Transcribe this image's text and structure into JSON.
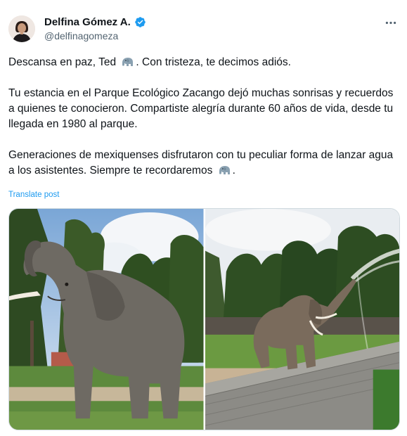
{
  "author": {
    "name": "Delfina Gómez A.",
    "handle": "@delfinagomeza",
    "verified": true,
    "avatar_icon": "avatar"
  },
  "tweet": {
    "line1_a": "Descansa en paz, Ted",
    "line1_b": ". Con tristeza, te decimos adiós.",
    "para2": "Tu estancia en el Parque Ecológico Zacango dejó muchas sonrisas y recuerdos a quienes te conocieron. Compartiste alegría durante 60 años de vida, desde tu llegada en 1980 al parque.",
    "para3_a": "Generaciones de mexiquenses disfrutaron con tu peculiar forma de lanzar agua a los asistentes. Siempre te recordaremos",
    "para3_b": ".",
    "emoji": "elephant-emoji"
  },
  "translate_label": "Translate post",
  "media": {
    "photo_count": 2,
    "photo1": "elephant-trunk-raised",
    "photo2": "elephant-spraying-water"
  },
  "colors": {
    "link": "#1d9bf0",
    "secondary_text": "#536471",
    "verified": "#1d9bf0"
  }
}
